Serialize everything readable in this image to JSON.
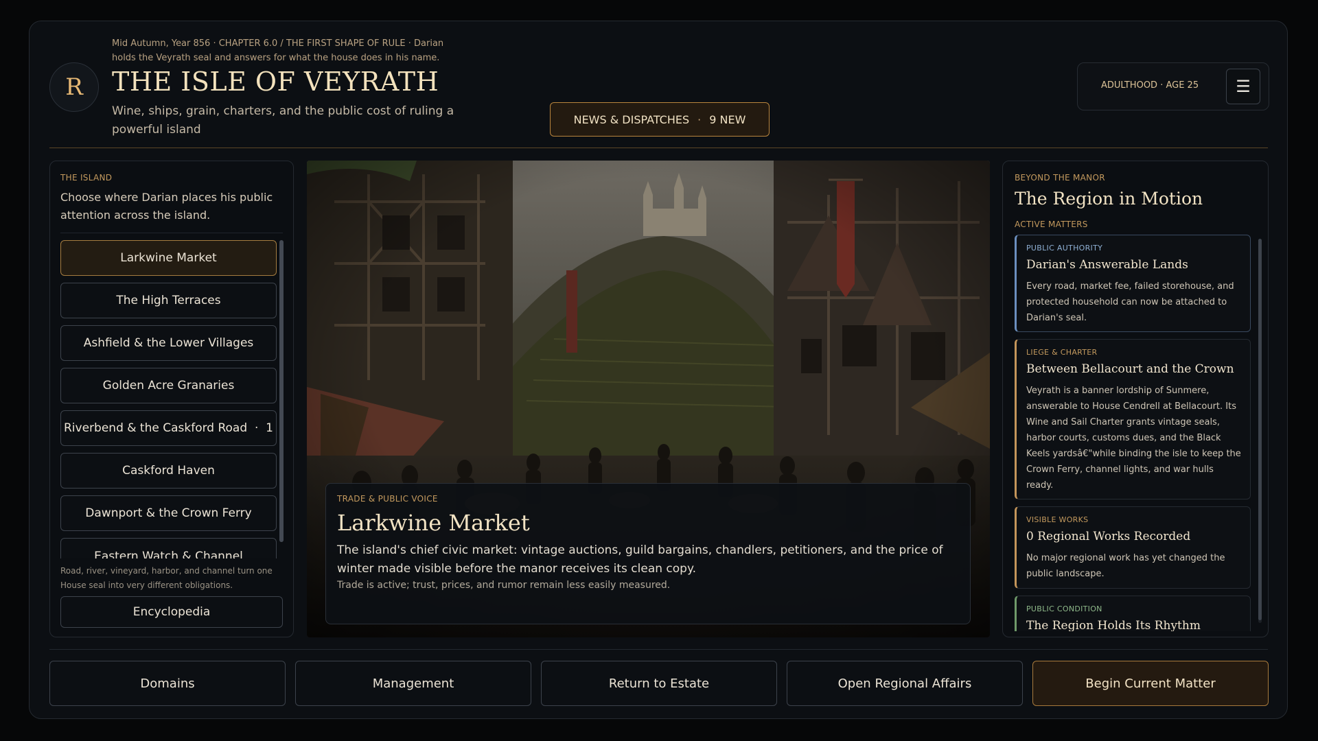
{
  "header": {
    "crest_letter": "R",
    "meta_line": "Mid Autumn, Year 856 · CHAPTER 6.0 / THE FIRST SHAPE OF RULE · Darian holds the Veyrath seal and answers for what the house does in his name.",
    "title": "THE ISLE OF VEYRATH",
    "subtitle": "Wine, ships, grain, charters, and the public cost of ruling a powerful island",
    "news_label": "NEWS & DISPATCHES",
    "news_separator": "·",
    "news_count": "9 NEW",
    "life_stage": "ADULTHOOD · AGE 25",
    "menu_icon": "☰"
  },
  "left_panel": {
    "label": "THE ISLAND",
    "description": "Choose where Darian places his public attention across the island.",
    "locations": [
      {
        "label": "Larkwine Market",
        "active": true
      },
      {
        "label": "The High Terraces"
      },
      {
        "label": "Ashfield & the Lower Villages"
      },
      {
        "label": "Golden Acre Granaries"
      },
      {
        "label": "Riverbend & the Caskford Road  ·  1"
      },
      {
        "label": "Caskford Haven"
      },
      {
        "label": "Dawnport & the Crown Ferry"
      },
      {
        "label": "Eastern Watch & Channel"
      }
    ],
    "note": "Road, river, vineyard, harbor, and channel turn one House seal into very different obligations.",
    "encyclopedia_label": "Encyclopedia"
  },
  "scene": {
    "label": "TRADE & PUBLIC VOICE",
    "title": "Larkwine Market",
    "description": "The island's chief civic market: vintage auctions, guild bargains, chandlers, petitioners, and the price of winter made visible before the manor receives its clean copy.",
    "status": "Trade is active; trust, prices, and rumor remain less easily measured."
  },
  "right_panel": {
    "label": "BEYOND THE MANOR",
    "title": "The Region in Motion",
    "sub_label": "ACTIVE MATTERS",
    "matters": [
      {
        "category": "PUBLIC AUTHORITY",
        "title": "Darian's Answerable Lands",
        "body": "Every road, market fee, failed storehouse, and protected household can now be attached to Darian's seal."
      },
      {
        "category": "LIEGE & CHARTER",
        "title": "Between Bellacourt and the Crown",
        "body": "Veyrath is a banner lordship of Sunmere, answerable to House Cendrell at Bellacourt. Its Wine and Sail Charter grants vintage seals, harbor courts, customs dues, and the Black Keels yardsâ€\"while binding the isle to keep the Crown Ferry, channel lights, and war hulls ready."
      },
      {
        "category": "VISIBLE WORKS",
        "title": "0 Regional Works Recorded",
        "body": "No major regional work has yet changed the public landscape."
      },
      {
        "category": "PUBLIC CONDITION",
        "title": "The Region Holds Its Rhythm",
        "body": ""
      }
    ]
  },
  "bottom_bar": {
    "domains": "Domains",
    "management": "Management",
    "return_estate": "Return to Estate",
    "regional_affairs": "Open Regional Affairs",
    "begin_matter": "Begin Current Matter"
  },
  "colors": {
    "accent_gold": "#c49a5e",
    "title_cream": "#f3e2bd",
    "background": "#0c0f13",
    "authority_blue": "#6b8fbf",
    "condition_green": "#6f9a6a"
  }
}
